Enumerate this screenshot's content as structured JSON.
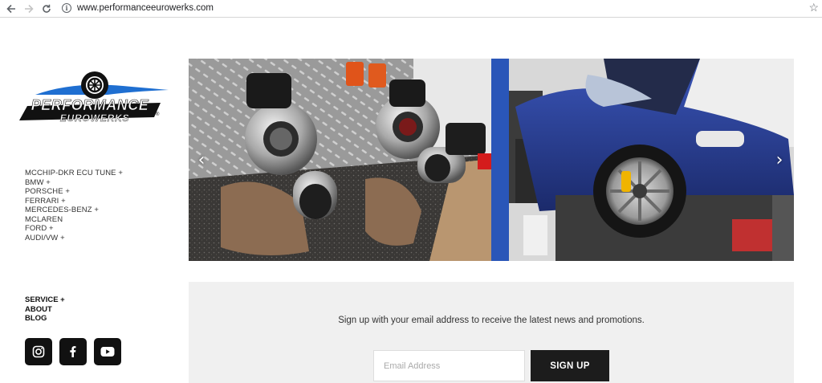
{
  "browser": {
    "back_icon": "arrow-left-icon",
    "forward_icon": "arrow-right-icon",
    "reload_icon": "reload-icon",
    "url": "www.performanceeurowerks.com",
    "star_icon": "star-icon"
  },
  "brand": {
    "logo_line1": "PERFORMANCE",
    "logo_line2": "EUROWERKS",
    "logo_mark": "®",
    "colors": {
      "blue": "#1f6fd1",
      "black": "#111111"
    }
  },
  "menu": {
    "items": [
      "MCCHIP-DKR ECU TUNE +",
      "BMW +",
      "PORSCHE +",
      "FERRARI +",
      "MERCEDES-BENZ +",
      "MCLAREN",
      "FORD +",
      "AUDI/VW +"
    ]
  },
  "secondary_menu": {
    "items": [
      "SERVICE +",
      "ABOUT",
      "BLOG"
    ]
  },
  "socials": [
    "instagram-icon",
    "facebook-icon",
    "youtube-icon"
  ],
  "hero": {
    "prev_icon": "‹",
    "next_icon": "›"
  },
  "newsletter": {
    "text": "Sign up with your email address to receive the latest news and promotions.",
    "email_placeholder": "Email Address",
    "email_value": "",
    "button_label": "SIGN UP"
  }
}
